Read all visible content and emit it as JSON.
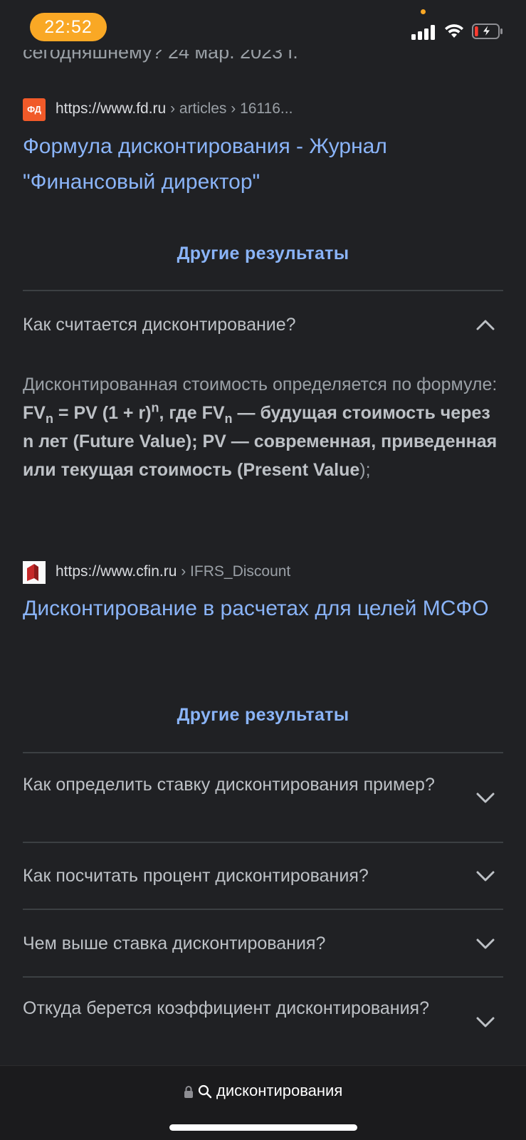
{
  "status_bar": {
    "time": "22:52",
    "battery_level": 0.15
  },
  "cut_text": "сегодняшнему? 24 мар. 2023 г.",
  "results": [
    {
      "favicon_text": "ФД",
      "site": "https://www.fd.ru",
      "path": " › articles › 16116...",
      "title": "Формула дисконтирования - Журнал \"Финансовый директор\""
    },
    {
      "favicon_text": "",
      "site": "https://www.cfin.ru",
      "path": " › IFRS_Discount",
      "title": "Дисконтирование в расчетах для целей МСФО"
    }
  ],
  "more_results_label": "Другие результаты",
  "faq": [
    {
      "question": "Как считается дисконтирование?",
      "expanded": true
    },
    {
      "question": "Как определить ставку дисконтирования пример?",
      "expanded": false
    },
    {
      "question": "Как посчитать процент дисконтирования?",
      "expanded": false
    },
    {
      "question": "Чем выше ставка дисконтирования?",
      "expanded": false
    },
    {
      "question": "Откуда берется коэффициент дисконтирования?",
      "expanded": false
    }
  ],
  "answer": {
    "plain_start": "Дисконтированная стоимость определяется по формуле: ",
    "fv": "FV",
    "sub_n": "n",
    "eq": " = PV (1 + r)",
    "sup_n": "n",
    "mid": ", где FV",
    "sub_n2": "n",
    "bold_rest": " — будущая стоимость через n лет (Future Value); PV — современная, приведенная или текущая стоимость (Present Value",
    "plain_end": ");"
  },
  "address_bar": {
    "query": "дисконтирования"
  }
}
